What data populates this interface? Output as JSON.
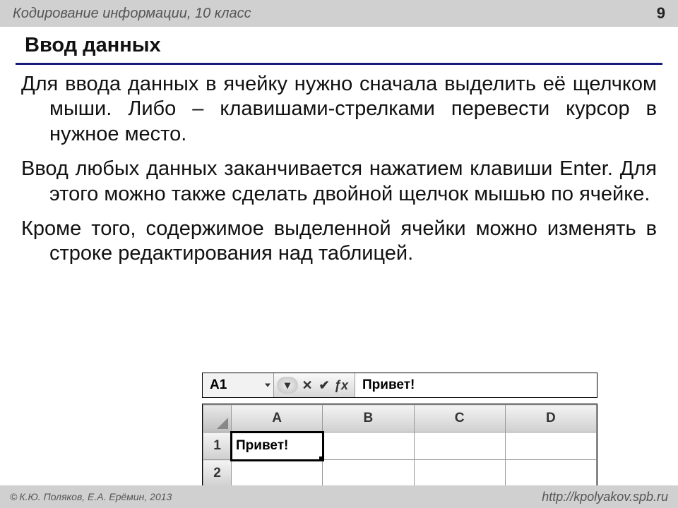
{
  "header": {
    "course": "Кодирование информации, 10 класс",
    "page": "9"
  },
  "title": "Ввод данных",
  "paragraphs": {
    "p1": "Для ввода данных в ячейку нужно сначала выделить её щелчком мыши. Либо – клавишами-стрелками перевести курсор в нужное место.",
    "p2": "Ввод любых данных заканчивается нажатием клавиши Enter. Для этого можно также сделать двойной щелчок мышью по ячейке.",
    "p3": "Кроме того, содержимое выделенной ячейки можно изменять в строке редактирования над таблицей."
  },
  "sheet": {
    "namebox": "A1",
    "formula_value": "Привет!",
    "columns": [
      "A",
      "B",
      "C",
      "D"
    ],
    "rows": [
      "1",
      "2"
    ],
    "active_cell_value": "Привет!",
    "fx_label": "ƒx",
    "cancel_icon": "✕",
    "accept_icon": "✔"
  },
  "footer": {
    "copyright_symbol": "©",
    "left": "К.Ю. Поляков, Е.А. Ерёмин, 2013",
    "right": "http://kpolyakov.spb.ru"
  }
}
